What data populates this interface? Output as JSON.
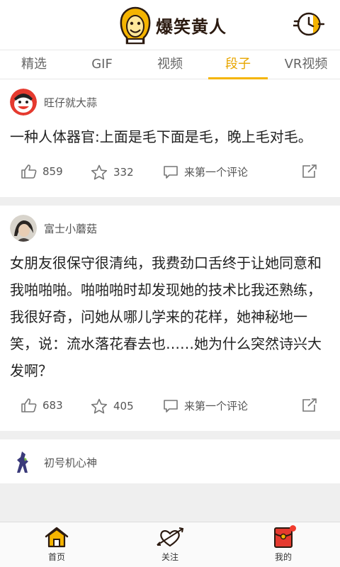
{
  "header": {
    "app_title": "爆笑黄人",
    "clock_icon": "clock-history-icon"
  },
  "tabs": [
    {
      "label": "精选",
      "active": false
    },
    {
      "label": "GIF",
      "active": false
    },
    {
      "label": "视频",
      "active": false
    },
    {
      "label": "段子",
      "active": true
    },
    {
      "label": "VR视频",
      "active": false
    }
  ],
  "posts": [
    {
      "author": "旺仔就大蒜",
      "text": "一种人体器官:上面是毛下面是毛，晚上毛对毛。",
      "likes": "859",
      "favorites": "332",
      "comment_label": "来第一个评论"
    },
    {
      "author": "富士小蘑菇",
      "text": "女朋友很保守很清纯，我费劲口舌终于让她同意和我啪啪啪。啪啪啪时却发现她的技术比我还熟练，我很好奇，问她从哪儿学来的花样，她神秘地一笑，说：流水落花春去也……她为什么突然诗兴大发啊？",
      "likes": "683",
      "favorites": "405",
      "comment_label": "来第一个评论"
    },
    {
      "author": "初号机心神"
    }
  ],
  "bottom_nav": [
    {
      "label": "首页",
      "icon": "home-icon",
      "active": true
    },
    {
      "label": "关注",
      "icon": "heart-arrow-icon",
      "active": false
    },
    {
      "label": "我的",
      "icon": "red-envelope-icon",
      "active": false
    }
  ],
  "colors": {
    "accent": "#f5b400",
    "active_tab_text": "#e8a600",
    "notification_dot": "#f03c2e"
  }
}
